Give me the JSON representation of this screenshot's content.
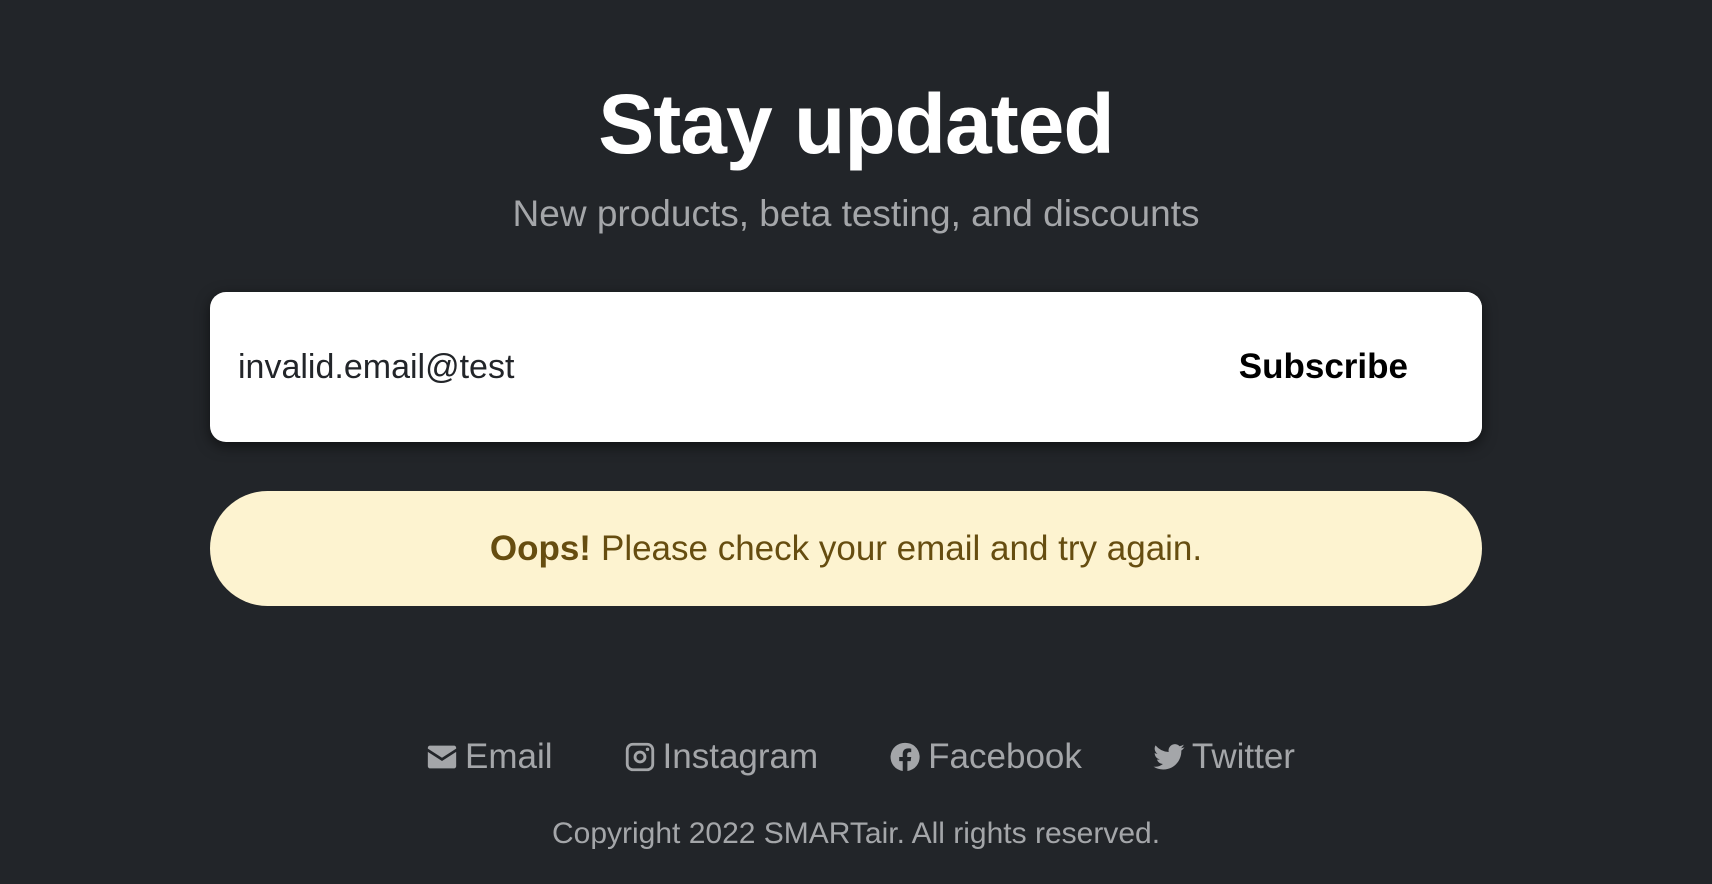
{
  "header": {
    "title": "Stay updated",
    "subtitle": "New products, beta testing, and discounts"
  },
  "form": {
    "email_value": "invalid.email@test",
    "subscribe_label": "Subscribe"
  },
  "alert": {
    "strong": "Oops!",
    "message": "Please check your email and try again."
  },
  "social": [
    {
      "label": "Email",
      "icon": "envelope-icon"
    },
    {
      "label": "Instagram",
      "icon": "instagram-icon"
    },
    {
      "label": "Facebook",
      "icon": "facebook-icon"
    },
    {
      "label": "Twitter",
      "icon": "twitter-icon"
    }
  ],
  "footer": {
    "copyright": "Copyright 2022 SMARTair. All rights reserved."
  },
  "colors": {
    "background": "#222529",
    "alert_background": "#fdf3d0",
    "alert_text": "#664d10",
    "muted_text": "#a4a6a9"
  }
}
